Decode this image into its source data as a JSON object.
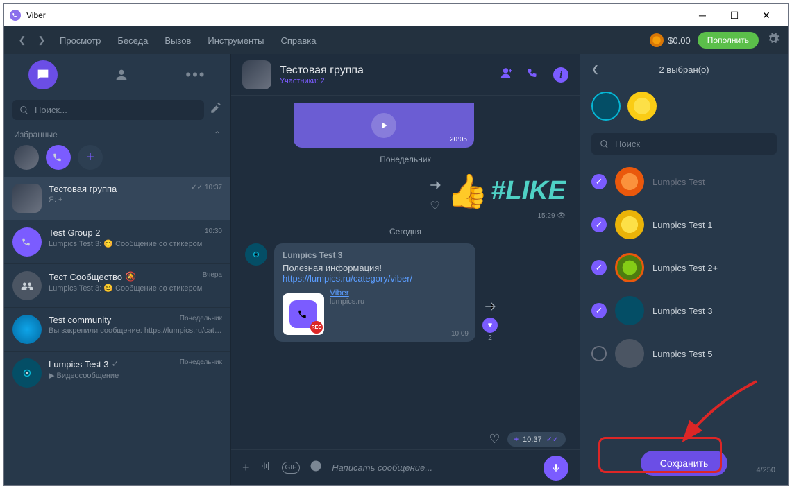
{
  "titlebar": {
    "app_name": "Viber"
  },
  "menubar": {
    "items": [
      "Просмотр",
      "Беседа",
      "Вызов",
      "Инструменты",
      "Справка"
    ],
    "balance": "$0.00",
    "topup": "Пополнить"
  },
  "sidebar": {
    "search_placeholder": "Поиск...",
    "favorites_label": "Избранные",
    "chats": [
      {
        "title": "Тестовая группа",
        "sub": "Я: +",
        "meta": "10:37",
        "checks": "✓✓"
      },
      {
        "title": "Test Group 2",
        "sub": "Lumpics Test 3: 😊 Сообщение со стикером",
        "meta": "10:30"
      },
      {
        "title": "Тест Сообщество",
        "sub": "Lumpics Test 3: 😊 Сообщение со стикером",
        "meta": "Вчера",
        "mute": true
      },
      {
        "title": "Test community",
        "sub": "Вы закрепили сообщение: https://lumpics.ru/category/viber/",
        "meta": "Понедельник"
      },
      {
        "title": "Lumpics Test 3",
        "sub": "▶ Видеосообщение",
        "meta": "Понедельник",
        "verified": true
      }
    ]
  },
  "chat": {
    "title": "Тестовая группа",
    "subtitle": "Участники: 2",
    "video_time": "20:05",
    "day1": "Понедельник",
    "like_hash": "#LIKE",
    "like_time": "15:29",
    "day2": "Сегодня",
    "msg_sender": "Lumpics Test 3",
    "msg_text": "Полезная информация! ",
    "msg_link": "https://lumpics.ru/category/viber/",
    "link_title": "Viber",
    "link_domain": "lumpics.ru",
    "msg_time": "10:09",
    "reaction_count": "2",
    "sent_time": "10:37",
    "composer_placeholder": "Написать сообщение..."
  },
  "rightpanel": {
    "header": "2 выбран(о)",
    "search_placeholder": "Поиск",
    "contacts": [
      {
        "name": "Lumpics Test",
        "checked": true,
        "dim": true,
        "color": "c-orange"
      },
      {
        "name": "Lumpics Test 1",
        "checked": true,
        "color": "c-lemon"
      },
      {
        "name": "Lumpics Test 2+",
        "checked": true,
        "color": "c-lime"
      },
      {
        "name": "Lumpics Test 3",
        "checked": true,
        "color": "c-cyan"
      },
      {
        "name": "Lumpics Test 5",
        "checked": false,
        "color": "c-grey"
      }
    ],
    "save": "Сохранить",
    "counter": "4/250"
  }
}
